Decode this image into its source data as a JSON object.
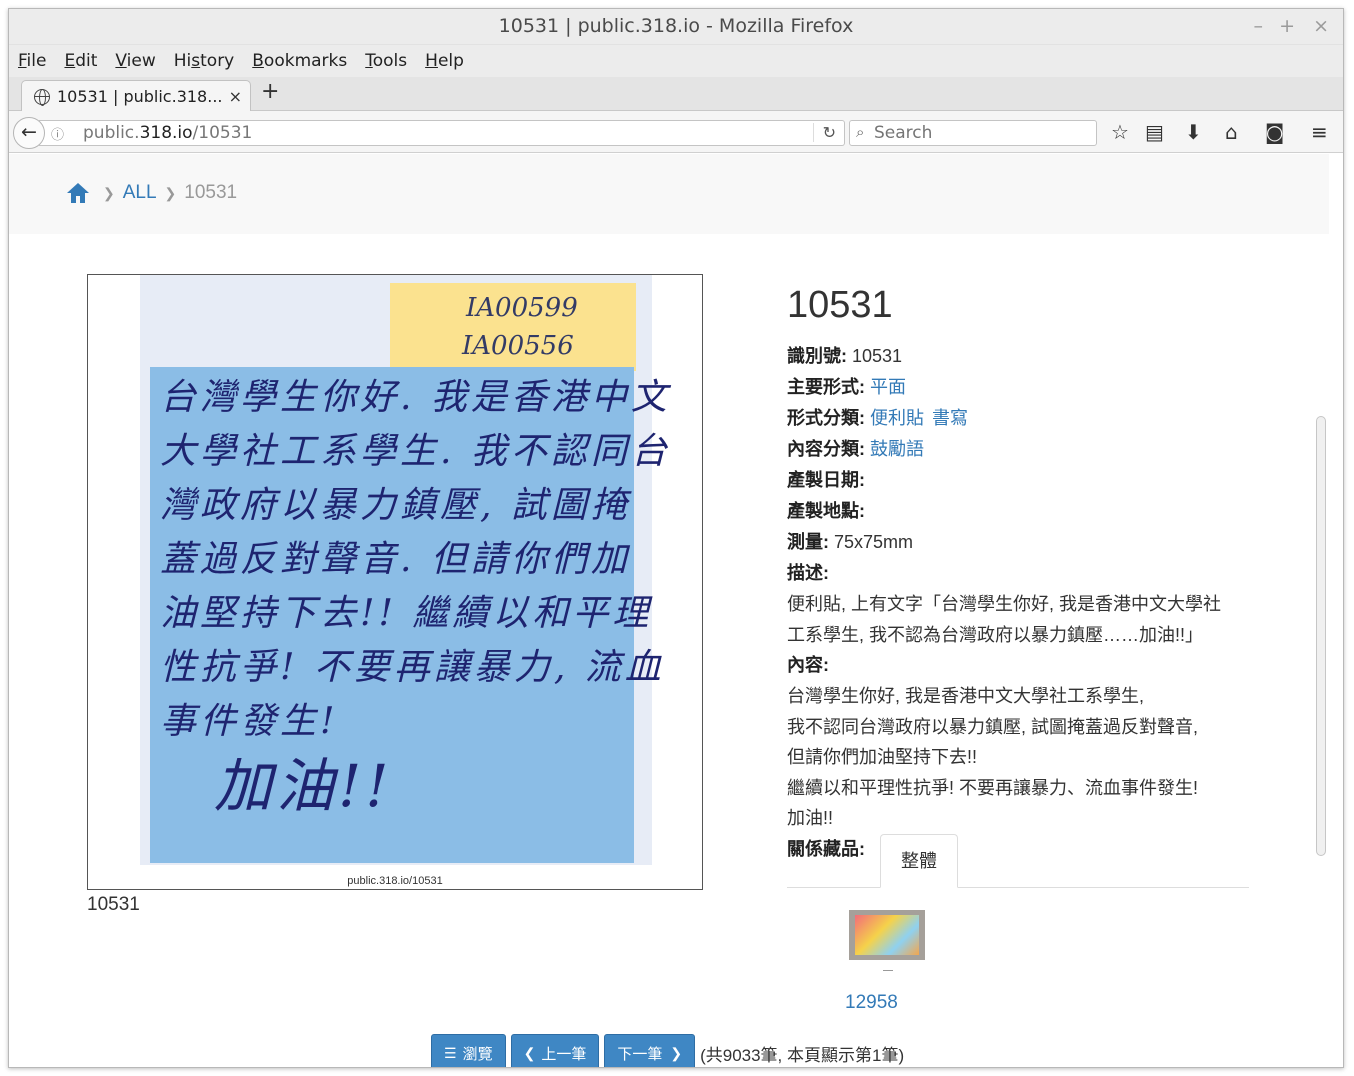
{
  "window": {
    "title": "10531 | public.318.io - Mozilla Firefox",
    "min_glyph": "–",
    "max_glyph": "+",
    "close_glyph": "×"
  },
  "menu": {
    "items": [
      {
        "ul": "F",
        "rest": "ile"
      },
      {
        "ul": "E",
        "rest": "dit"
      },
      {
        "ul": "V",
        "rest": "iew"
      },
      {
        "pre": "Hi",
        "ul": "s",
        "rest": "tory"
      },
      {
        "ul": "B",
        "rest": "ookmarks"
      },
      {
        "ul": "T",
        "rest": "ools"
      },
      {
        "ul": "H",
        "rest": "elp"
      }
    ]
  },
  "tabs": {
    "active_label": "10531 | public.318...",
    "close_glyph": "×",
    "new_tab_glyph": "+"
  },
  "nav": {
    "url_host": "public.318.io",
    "url_pre": "public.",
    "url_bold": "318.io",
    "url_path": "/10531",
    "search_placeholder": "Search"
  },
  "breadcrumb": {
    "all": "ALL",
    "current": "10531"
  },
  "photo": {
    "code1": "IA00599",
    "code2": "IA00556",
    "hand_lines": [
      "台灣學生你好. 我是香港中文",
      "大學社工系學生. 我不認同台",
      "灣政府以暴力鎮壓, 試圖掩",
      "蓋過反對聲音. 但請你們加",
      "油堅持下去!! 繼續以和平理",
      "性抗爭! 不要再讓暴力, 流血",
      "事件發生!"
    ],
    "hand_cheer": "加油!!",
    "watermark": "public.318.io/10531",
    "caption": "10531"
  },
  "details": {
    "heading": "10531",
    "id_label": "識別號:",
    "id_value": "10531",
    "form_label": "主要形式:",
    "form_value": "平面",
    "type_label": "形式分類:",
    "type_values": [
      "便利貼",
      "書寫"
    ],
    "content_cat_label": "內容分類:",
    "content_cat_value": "鼓勵語",
    "date_label": "產製日期:",
    "place_label": "產製地點:",
    "measure_label": "測量:",
    "measure_value": "75x75mm",
    "desc_label": "描述:",
    "desc_lines": [
      "便利貼, 上有文字「台灣學生你好, 我是香港中文大學社",
      "工系學生, 我不認為台灣政府以暴力鎮壓……加油!!」"
    ],
    "content_label": "內容:",
    "content_lines": [
      "台灣學生你好, 我是香港中文大學社工系學生,",
      "我不認同台灣政府以暴力鎮壓, 試圖掩蓋過反對聲音,",
      "但請你們加油堅持下去!!",
      "繼續以和平理性抗爭! 不要再讓暴力、流血事件發生!",
      "加油!!"
    ],
    "related_label": "關係藏品:",
    "related_tab": "整體",
    "related_item": "12958"
  },
  "pager": {
    "browse": "瀏覽",
    "prev": "上一筆",
    "next": "下一筆",
    "info": "(共9033筆, 本頁顯示第1筆)"
  },
  "colors": {
    "link": "#337ab7",
    "button": "#3f87c4"
  }
}
